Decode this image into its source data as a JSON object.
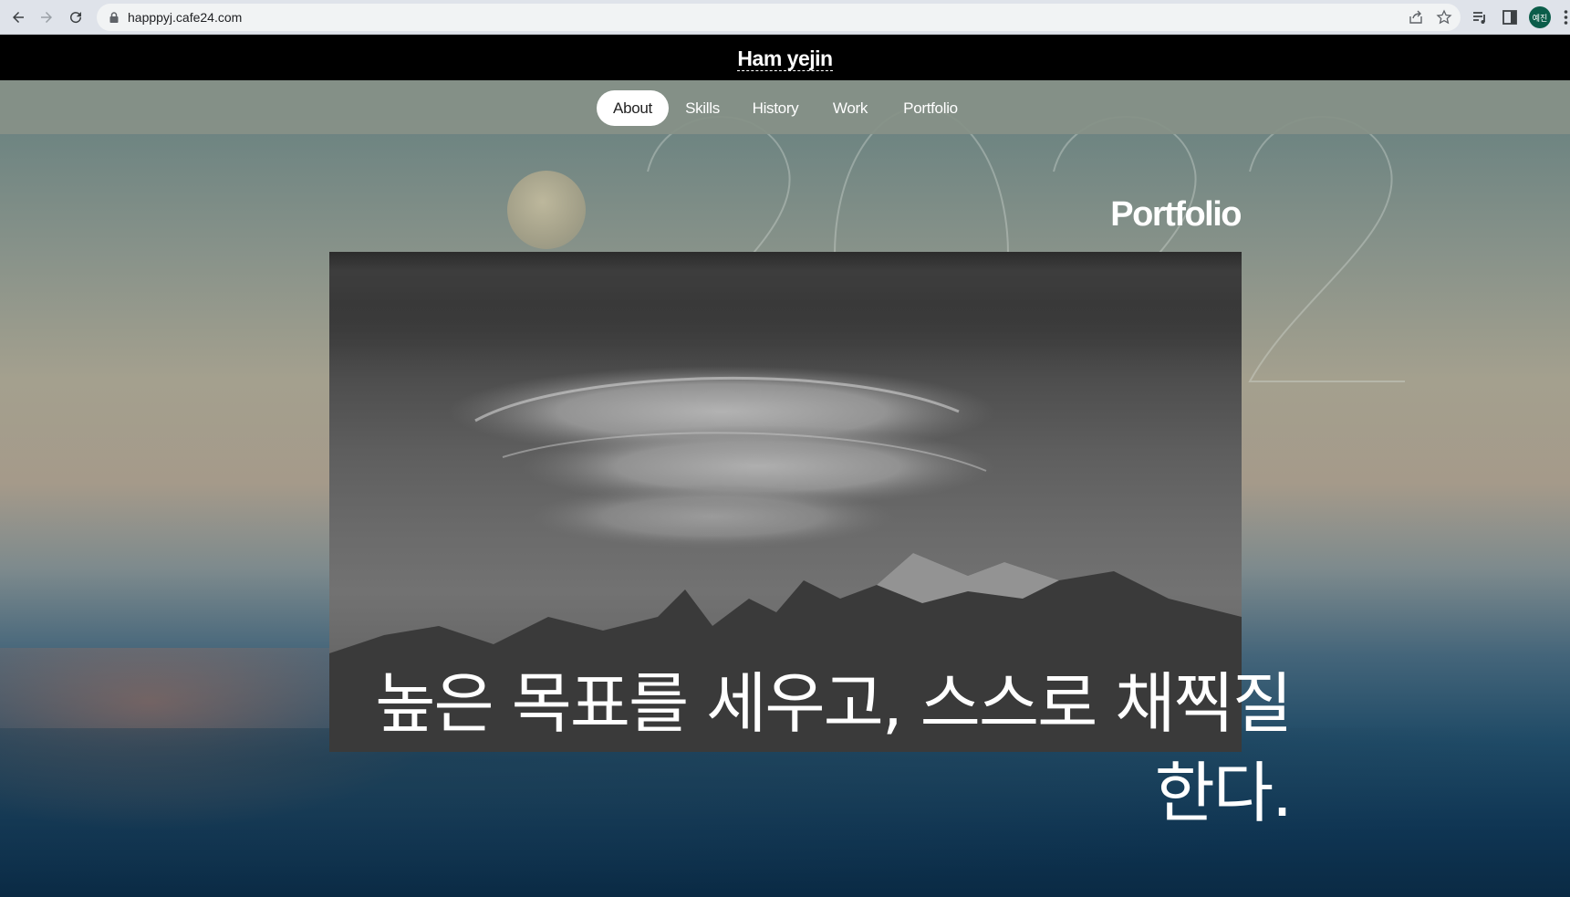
{
  "browser": {
    "url": "happpyj.cafe24.com",
    "profile_initials": "예진",
    "icons": [
      "back-icon",
      "forward-icon",
      "reload-icon",
      "lock-icon",
      "share-icon",
      "star-icon",
      "reading-list-icon",
      "side-panel-icon",
      "more-icon"
    ]
  },
  "site": {
    "title": "Ham yejin",
    "nav": [
      {
        "label": "About",
        "active": true
      },
      {
        "label": "Skills",
        "active": false
      },
      {
        "label": "History",
        "active": false
      },
      {
        "label": "Work",
        "active": false
      },
      {
        "label": "Portfolio",
        "active": false
      }
    ]
  },
  "section": {
    "heading": "Portfolio",
    "background_year": "2022",
    "quote": "높은 목표를 세우고, 스스로 채찍질 한다."
  },
  "colors": {
    "header_bg": "#000000",
    "nav_bg": "#869188",
    "active_pill": "#ffffff",
    "text": "#ffffff"
  }
}
